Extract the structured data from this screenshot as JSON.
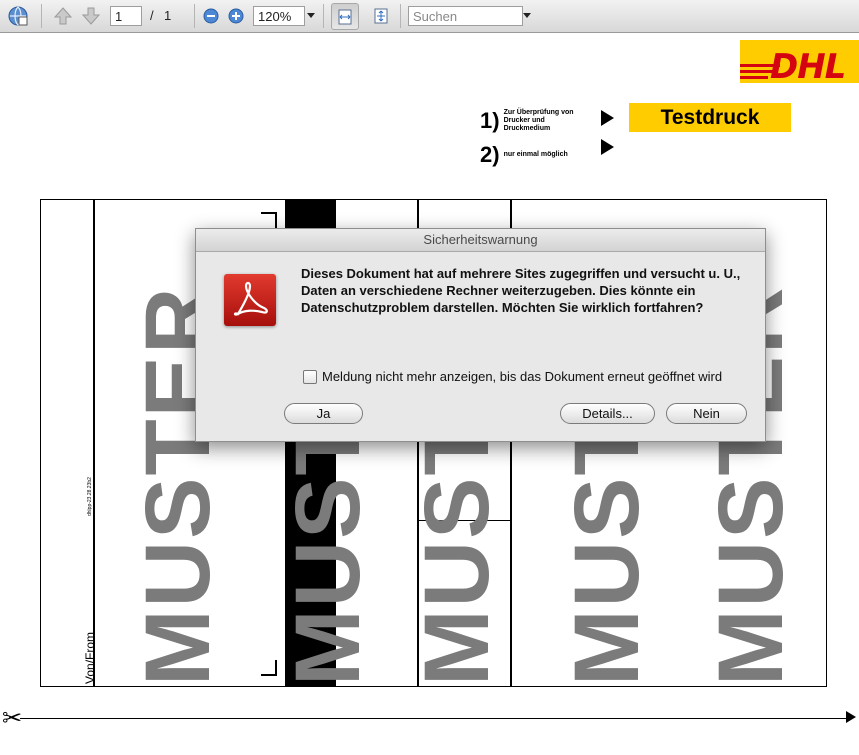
{
  "toolbar": {
    "page_current": "1",
    "page_separator": "/",
    "page_total": "1",
    "zoom": "120%",
    "search_placeholder": "Suchen",
    "icons": [
      "globe-icon",
      "arrow-up-icon",
      "arrow-down-icon",
      "zoom-out-icon",
      "zoom-in-icon",
      "fit-width-icon",
      "fit-page-icon",
      "chevron-down-icon"
    ]
  },
  "page": {
    "logo": "DHL",
    "step1_num": "1)",
    "step1_note": "Zur Überprüfung von Drucker und Druckmedium",
    "step2_num": "2)",
    "step2_note": "nur einmal möglich",
    "testdruck": "Testdruck",
    "watermark": "MUSTER",
    "von_from": "Von/From",
    "small_code": "dhlpp-23.28.23b2"
  },
  "dialog": {
    "title": "Sicherheitswarnung",
    "message": "Dieses Dokument hat auf mehrere Sites zugegriffen und versucht u. U., Daten an verschiedene Rechner weiterzugeben. Dies könnte ein Datenschutzproblem darstellen. Möchten Sie wirklich fortfahren?",
    "checkbox_label": "Meldung nicht mehr anzeigen, bis das Dokument erneut geöffnet wird",
    "checkbox_checked": false,
    "btn_yes": "Ja",
    "btn_details": "Details...",
    "btn_no": "Nein"
  },
  "colors": {
    "dhl_yellow": "#ffcc00",
    "dhl_red": "#d40511",
    "watermark_gray": "#7b7b7b"
  }
}
